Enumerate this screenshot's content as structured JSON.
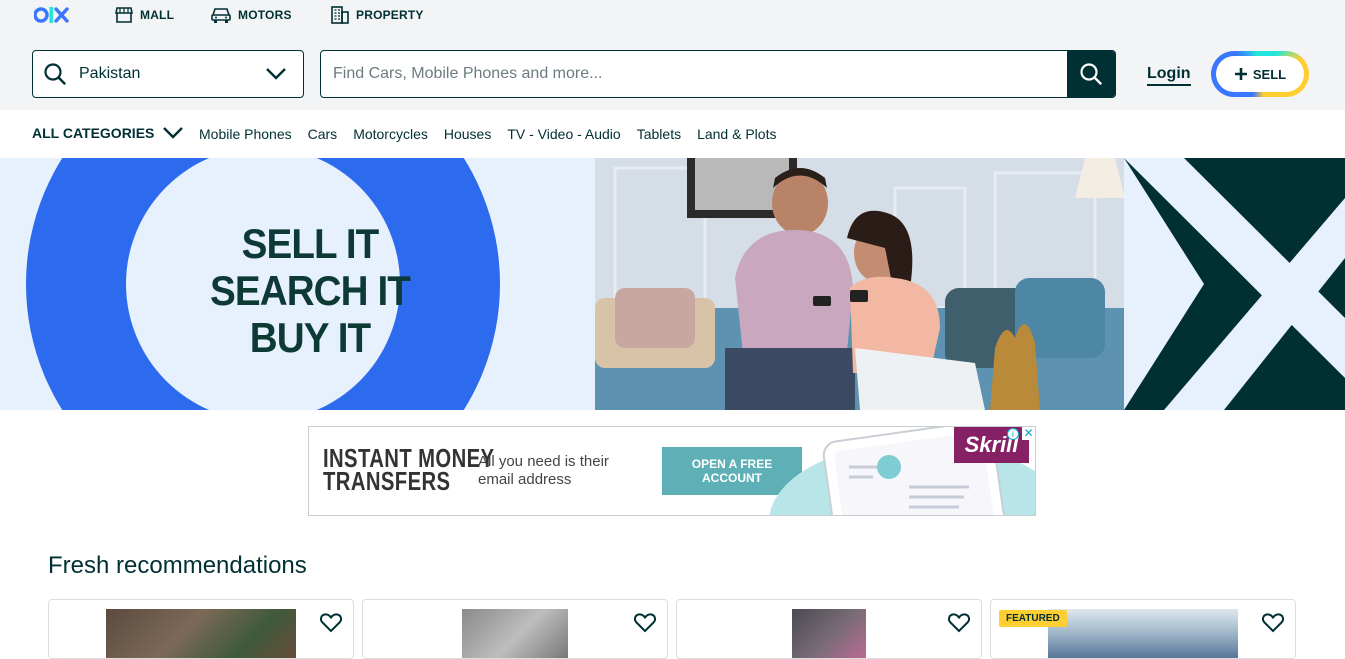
{
  "topnav": {
    "brand": "olx",
    "links": [
      {
        "label": "MALL",
        "icon": "storefront-icon"
      },
      {
        "label": "MOTORS",
        "icon": "car-icon"
      },
      {
        "label": "PROPERTY",
        "icon": "building-icon"
      }
    ]
  },
  "header": {
    "location_value": "Pakistan",
    "search_placeholder": "Find Cars, Mobile Phones and more...",
    "login_label": "Login",
    "sell_label": "SELL"
  },
  "categories": {
    "all_label": "ALL CATEGORIES",
    "items": [
      "Mobile Phones",
      "Cars",
      "Motorcycles",
      "Houses",
      "TV - Video - Audio",
      "Tablets",
      "Land & Plots"
    ]
  },
  "banner": {
    "lines": [
      "SELL IT",
      "SEARCH IT",
      "BUY IT"
    ]
  },
  "ad": {
    "title_line1": "INSTANT MONEY",
    "title_line2": "TRANSFERS",
    "subtitle": "All you need is their email address",
    "cta": "OPEN A FREE ACCOUNT",
    "brand": "Skrill",
    "close": "✕",
    "info": "i"
  },
  "recommendations": {
    "title": "Fresh recommendations",
    "featured_label": "FEATURED"
  },
  "colors": {
    "primary": "#002f34",
    "accent_blue": "#3a77ff",
    "accent_teal": "#23e5db",
    "accent_yellow": "#ffce32",
    "banner_ring": "#2c6bed"
  }
}
